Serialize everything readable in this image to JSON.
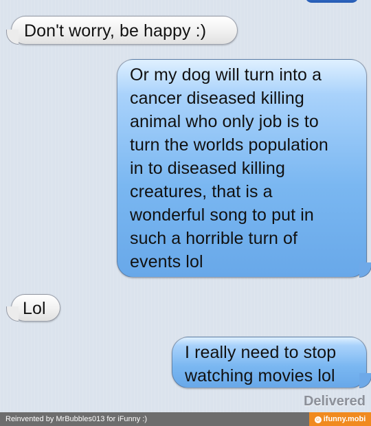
{
  "messages": [
    {
      "sender": "incoming",
      "text": "Don't worry, be happy :)"
    },
    {
      "sender": "outgoing",
      "text": "Or my dog will turn into a\ncancer diseased killing\nanimal who only job is to\nturn the worlds population\nin to diseased killing\ncreatures, that is a\nwonderful song to put in\nsuch a horrible turn of\nevents lol"
    },
    {
      "sender": "incoming",
      "text": "Lol"
    },
    {
      "sender": "outgoing",
      "text": "I really need to stop\nwatching movies lol"
    }
  ],
  "status": {
    "delivered": "Delivered"
  },
  "footer": {
    "credit": "Reinvented by MrBubbles013 for iFunny :)",
    "site": "ifunny.mobi"
  },
  "colors": {
    "incoming_bubble": "#f1f1f1",
    "outgoing_bubble": "#7ab7f1",
    "background": "#dbe3ed",
    "footer": "#6d6d6d",
    "accent": "#f08a1f"
  },
  "icons": {
    "site": "smiley-icon"
  }
}
